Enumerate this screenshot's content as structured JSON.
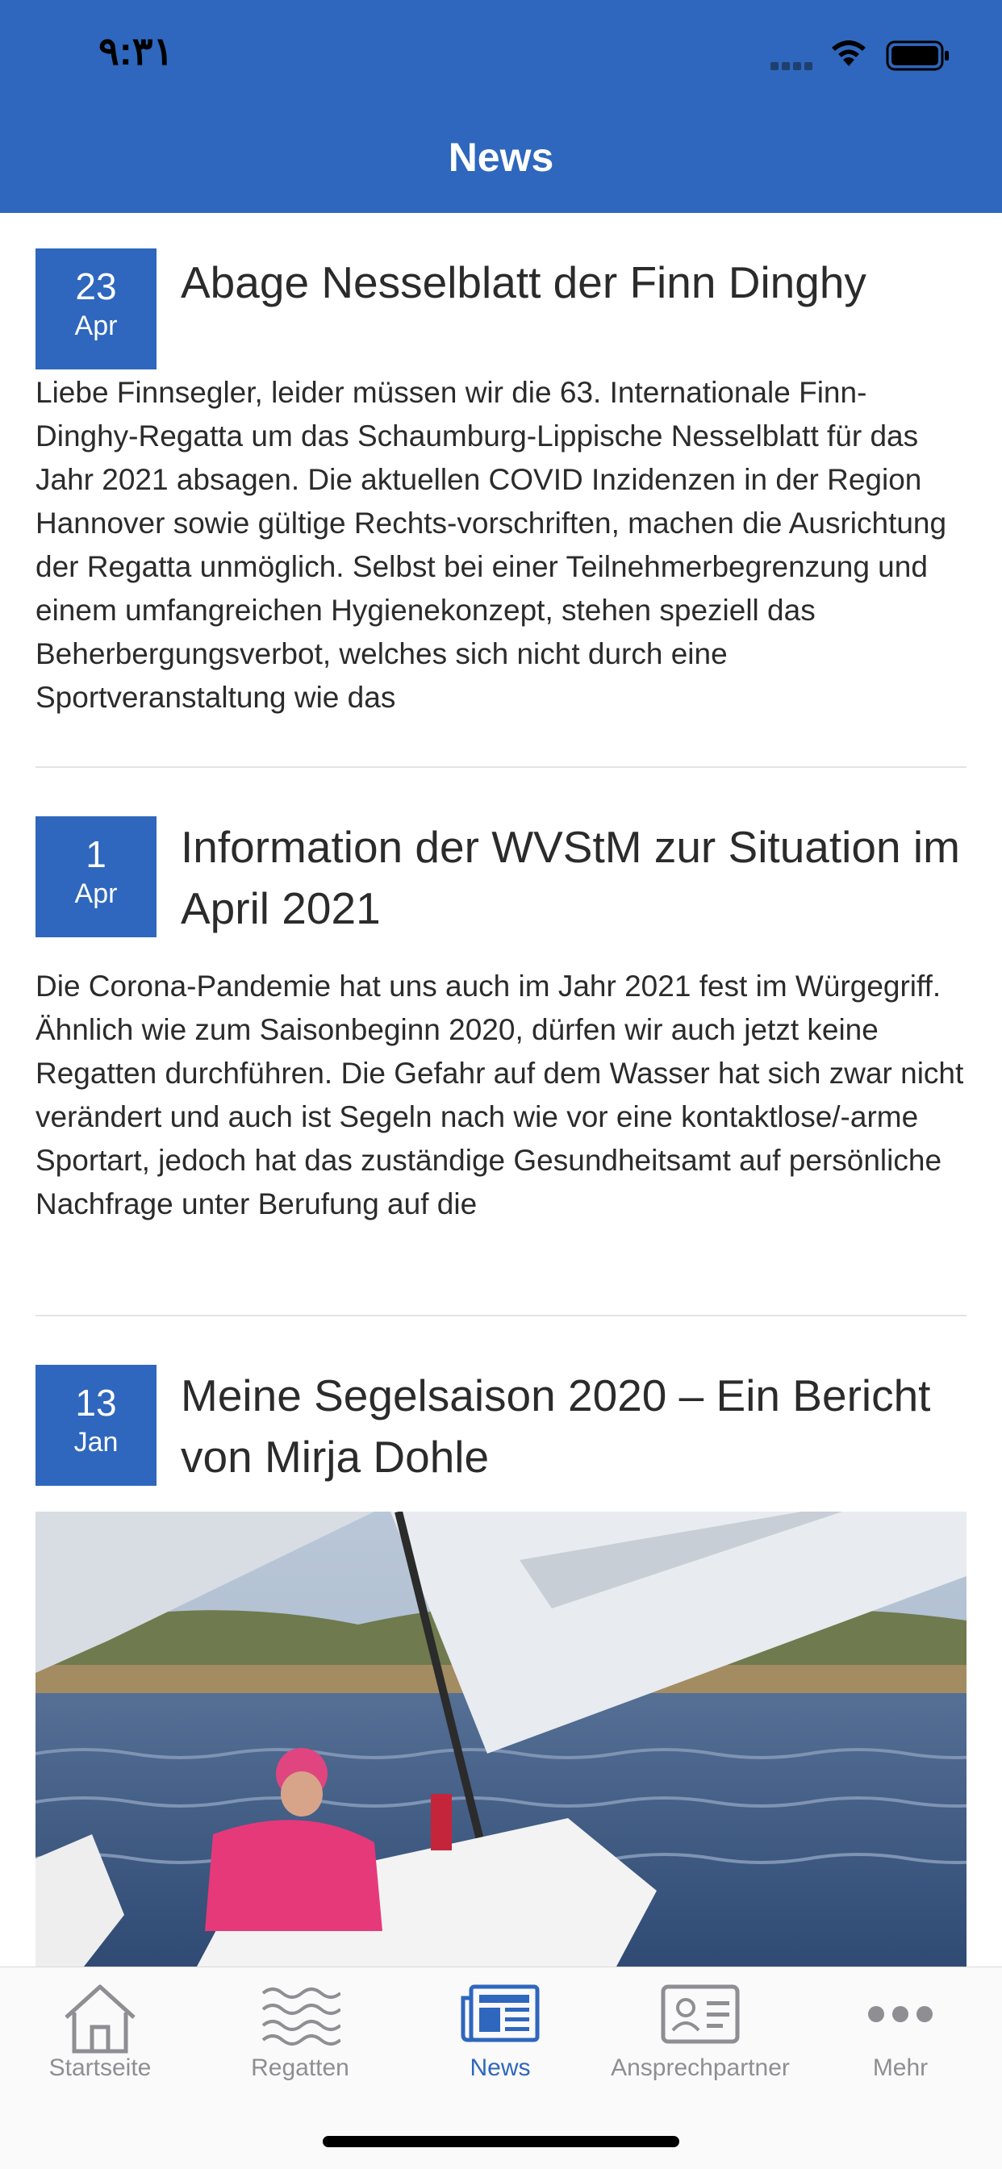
{
  "status_bar": {
    "time": "٩:٣١"
  },
  "header": {
    "title": "News"
  },
  "articles": [
    {
      "day": "23",
      "month": "Apr",
      "title": "Abage Nesselblatt der Finn Dinghy",
      "excerpt": "Liebe Finnsegler, leider müssen wir die 63. Internationale Finn-Dinghy-Regatta um das Schaumburg-Lippische Nesselblatt für das Jahr 2021 absagen. Die aktuellen COVID Inzidenzen in der Region Hannover sowie gültige Rechts-vorschriften, machen die Ausrichtung der Regatta unmöglich. Selbst bei einer Teilnehmerbegrenzung und einem umfangreichen Hygienekonzept, stehen speziell das Beherbergungsverbot, welches sich nicht durch eine Sportveranstaltung wie das"
    },
    {
      "day": "1",
      "month": "Apr",
      "title": "Information der WVStM zur Situation im April 2021",
      "excerpt": "Die Corona-Pandemie hat uns auch im Jahr 2021 fest im Würgegriff. Ähnlich wie zum Saisonbeginn 2020, dürfen wir auch jetzt keine Regatten durchführen. Die Gefahr auf dem Wasser hat sich zwar nicht verändert und auch ist Segeln nach wie vor eine kontaktlose/-arme Sportart, jedoch hat das zuständige Gesundheitsamt auf persönliche Nachfrage unter Berufung auf die"
    },
    {
      "day": "13",
      "month": "Jan",
      "title": "Meine Segelsaison 2020 – Ein Bericht von Mirja Dohle",
      "image": "sailing-dinghy-photo"
    }
  ],
  "tabbar": {
    "items": [
      {
        "label": "Startseite",
        "icon": "home-icon",
        "active": false
      },
      {
        "label": "Regatten",
        "icon": "waves-icon",
        "active": false
      },
      {
        "label": "News",
        "icon": "newspaper-icon",
        "active": true
      },
      {
        "label": "Ansprechpartner",
        "icon": "contact-card-icon",
        "active": false
      },
      {
        "label": "Mehr",
        "icon": "more-dots-icon",
        "active": false
      }
    ]
  },
  "colors": {
    "brand_blue": "#2e67bd",
    "inactive_gray": "#8e8e93"
  }
}
